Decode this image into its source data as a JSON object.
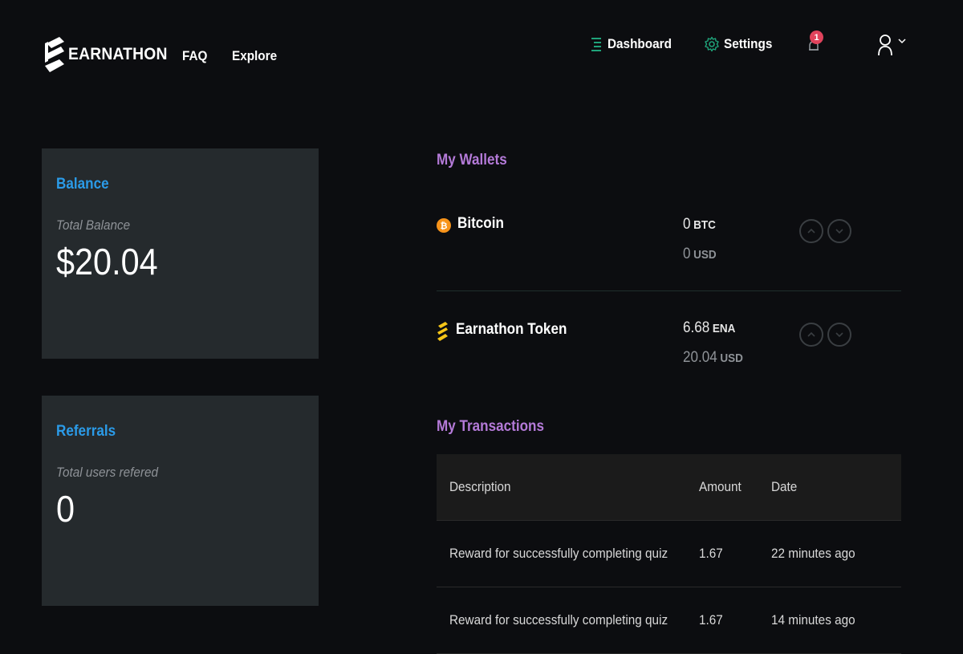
{
  "header": {
    "logo_text": "EARNATHON",
    "nav": {
      "faq": "FAQ",
      "explore": "Explore"
    },
    "dashboard_label": "Dashboard",
    "settings_label": "Settings",
    "notification_count": "1"
  },
  "balance_card": {
    "title": "Balance",
    "subtitle": "Total Balance",
    "value": "$20.04"
  },
  "referrals_card": {
    "title": "Referrals",
    "subtitle": "Total users refered",
    "value": "0"
  },
  "wallets": {
    "title": "My Wallets",
    "items": [
      {
        "name": "Bitcoin",
        "amount": "0",
        "currency": "BTC",
        "usd_amount": "0",
        "usd_label": "USD",
        "icon": "bitcoin-icon"
      },
      {
        "name": "Earnathon Token",
        "amount": "6.68",
        "currency": "ENA",
        "usd_amount": "20.04",
        "usd_label": "USD",
        "icon": "earnathon-token-icon"
      }
    ]
  },
  "transactions": {
    "title": "My Transactions",
    "columns": {
      "description": "Description",
      "amount": "Amount",
      "date": "Date"
    },
    "rows": [
      {
        "description": "Reward for successfully completing quiz",
        "amount": "1.67",
        "date": "22 minutes ago"
      },
      {
        "description": "Reward for successfully completing quiz",
        "amount": "1.67",
        "date": "14 minutes ago"
      }
    ]
  },
  "colors": {
    "background": "#0c0d10",
    "card": "#252a2d",
    "accent_blue": "#2b9be8",
    "accent_purple": "#b47ad8",
    "nav_icon_green": "#1fa37a",
    "badge_red": "#e0435c",
    "bitcoin_orange": "#f7931a",
    "token_yellow": "#f5c518"
  }
}
